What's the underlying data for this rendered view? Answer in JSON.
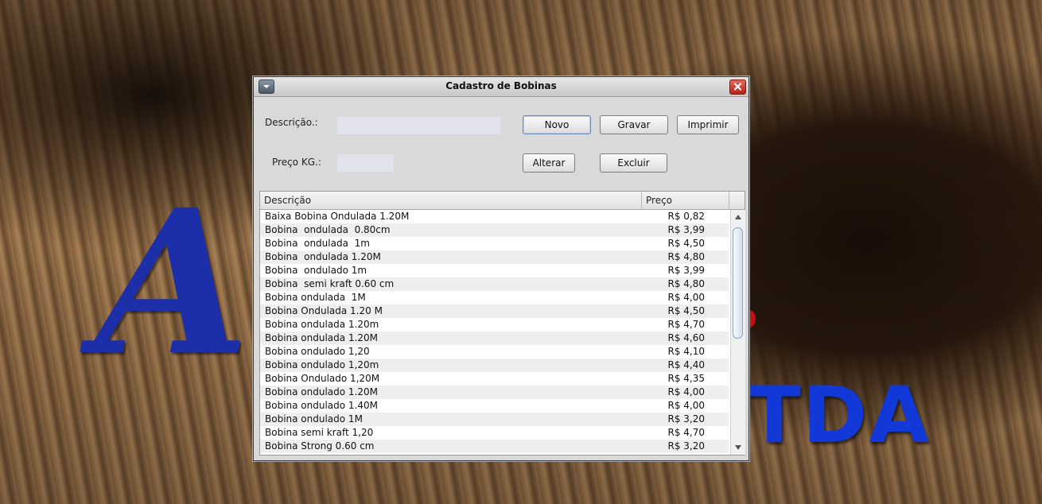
{
  "background": {
    "logo_letter": "A",
    "logo_text": "TDA"
  },
  "window": {
    "title": "Cadastro de Bobinas"
  },
  "form": {
    "descricao_label": "Descrição.:",
    "descricao_value": "",
    "preco_label": "Preço KG.:",
    "preco_value": ""
  },
  "buttons": {
    "novo": "Novo",
    "gravar": "Gravar",
    "imprimir": "Imprimir",
    "alterar": "Alterar",
    "excluir": "Excluir"
  },
  "table": {
    "columns": [
      "Descrição",
      "Preço"
    ],
    "rows": [
      {
        "descricao": "Baixa Bobina Ondulada 1.20M",
        "preco": "R$ 0,82"
      },
      {
        "descricao": "Bobina  ondulada  0.80cm",
        "preco": "R$ 3,99"
      },
      {
        "descricao": "Bobina  ondulada  1m",
        "preco": "R$ 4,50"
      },
      {
        "descricao": "Bobina  ondulada 1.20M",
        "preco": "R$ 4,80"
      },
      {
        "descricao": "Bobina  ondulado 1m",
        "preco": "R$ 3,99"
      },
      {
        "descricao": "Bobina  semi kraft 0.60 cm",
        "preco": "R$ 4,80"
      },
      {
        "descricao": "Bobina ondulada  1M",
        "preco": "R$ 4,00"
      },
      {
        "descricao": "Bobina Ondulada 1.20 M",
        "preco": "R$ 4,50"
      },
      {
        "descricao": "Bobina ondulada 1.20m",
        "preco": "R$ 4,70"
      },
      {
        "descricao": "Bobina ondulada 1.20M",
        "preco": "R$ 4,60"
      },
      {
        "descricao": "Bobina ondulado 1,20",
        "preco": "R$ 4,10"
      },
      {
        "descricao": "Bobina ondulado 1,20m",
        "preco": "R$ 4,40"
      },
      {
        "descricao": "Bobina Ondulado 1,20M",
        "preco": "R$ 4,35"
      },
      {
        "descricao": "Bobina ondulado 1.20M",
        "preco": "R$ 4,00"
      },
      {
        "descricao": "Bobina ondulado 1.40M",
        "preco": "R$ 4,00"
      },
      {
        "descricao": "Bobina ondulado 1M",
        "preco": "R$ 3,20"
      },
      {
        "descricao": "Bobina semi kraft 1,20",
        "preco": "R$ 4,70"
      },
      {
        "descricao": "Bobina Strong 0.60 cm",
        "preco": "R$ 3,20"
      }
    ]
  },
  "icons": {
    "system_menu": "chevron-down-icon",
    "close": "close-icon",
    "scroll_up": "arrow-up-icon",
    "scroll_down": "arrow-down-icon"
  },
  "colors": {
    "window_bg": "#d9d9d9",
    "close_button": "#c8382a",
    "logo_blue": "#1d2fa8"
  }
}
